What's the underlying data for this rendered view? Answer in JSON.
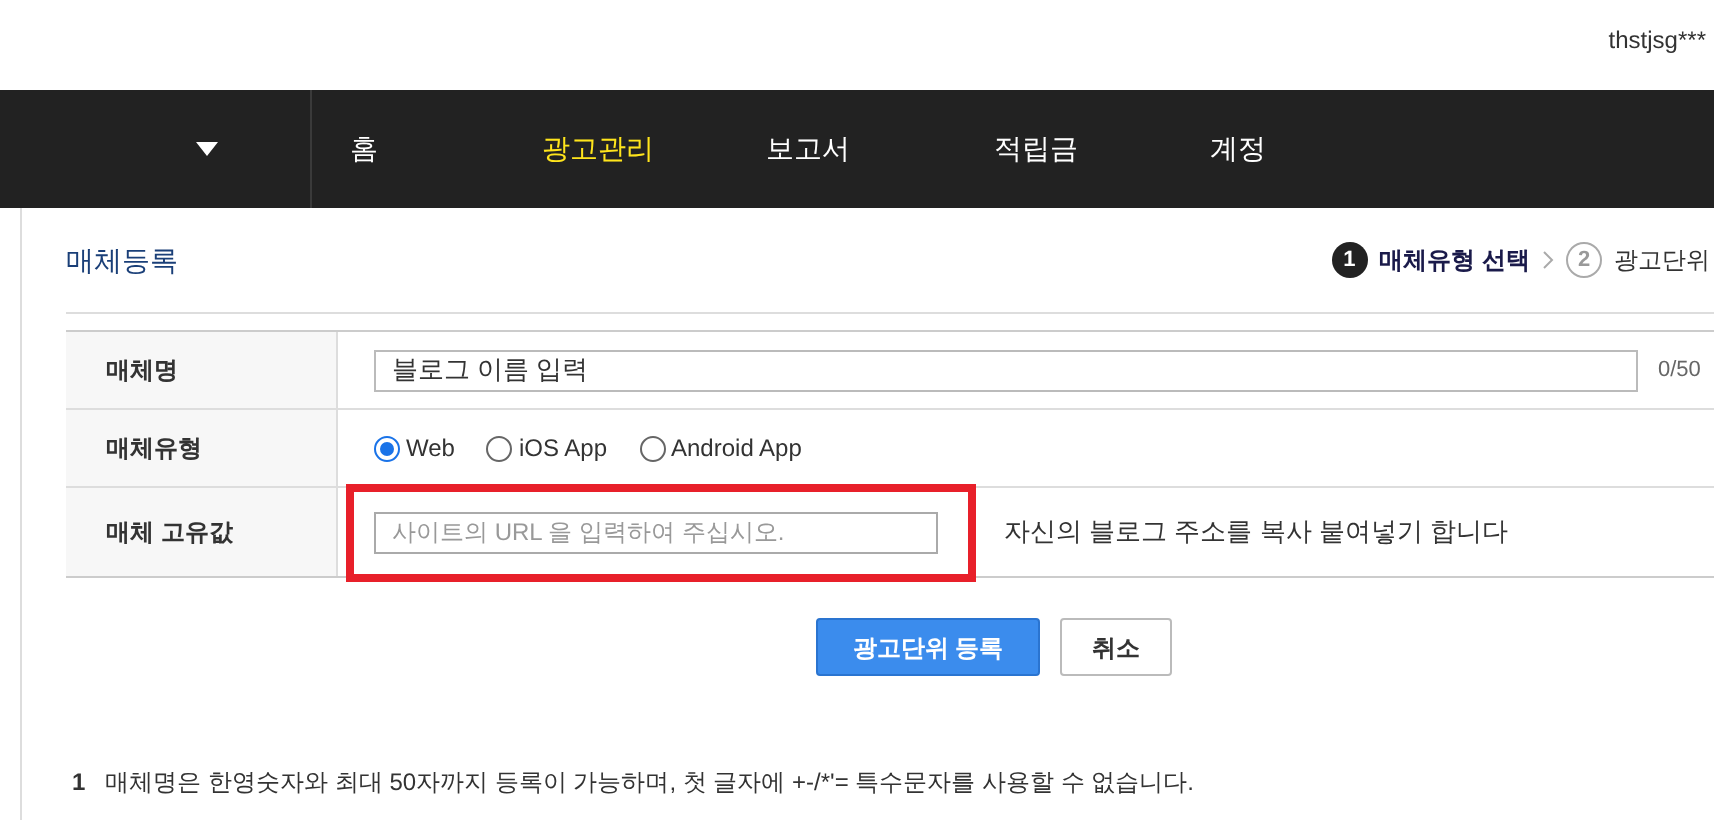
{
  "header": {
    "user": "thstjsg***"
  },
  "nav": {
    "items": [
      {
        "label": "홈",
        "selected": false
      },
      {
        "label": "광고관리",
        "selected": true
      },
      {
        "label": "보고서",
        "selected": false
      },
      {
        "label": "적립금",
        "selected": false
      },
      {
        "label": "계정",
        "selected": false
      }
    ]
  },
  "page_title": "매체등록",
  "steps": [
    {
      "number": "1",
      "label": "매체유형 선택",
      "selected": true
    },
    {
      "number": "2",
      "label": "광고단위",
      "selected": false
    }
  ],
  "form": {
    "name": {
      "label": "매체명",
      "value": "블로그 이름 입력",
      "count": "0/50"
    },
    "type": {
      "label": "매체유형",
      "options": [
        {
          "label": "Web",
          "selected": true
        },
        {
          "label": "iOS App",
          "selected": false
        },
        {
          "label": "Android App",
          "selected": false
        }
      ]
    },
    "unique": {
      "label": "매체 고유값",
      "placeholder": "사이트의 URL 을 입력하여 주십시오.",
      "hint": "자신의 블로그 주소를 복사 붙여넣기 합니다",
      "highlighted": true
    }
  },
  "buttons": [
    {
      "label": "광고단위 등록",
      "kind": "primary"
    },
    {
      "label": "취소",
      "kind": "secondary"
    }
  ],
  "notes": [
    {
      "number": "1",
      "text": "매체명은 한영숫자와 최대 50자까지 등록이 가능하며, 첫 글자에 +-/*'= 특수문자를 사용할 수 없습니다."
    }
  ]
}
